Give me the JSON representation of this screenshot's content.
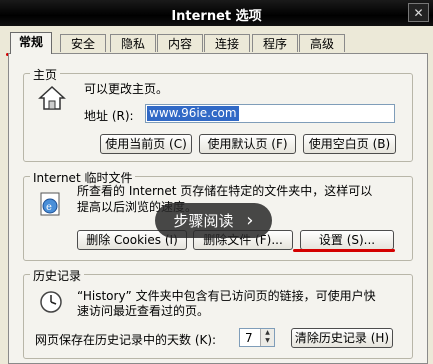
{
  "window": {
    "title": "Internet 选项",
    "close_glyph": "✕"
  },
  "tabs": [
    {
      "label": "常规",
      "active": true
    },
    {
      "label": "安全",
      "active": false
    },
    {
      "label": "隐私",
      "active": false
    },
    {
      "label": "内容",
      "active": false
    },
    {
      "label": "连接",
      "active": false
    },
    {
      "label": "程序",
      "active": false
    },
    {
      "label": "高级",
      "active": false
    }
  ],
  "homepage": {
    "group_label": "主页",
    "description": "可以更改主页。",
    "address_label": "地址 (R):",
    "address_value": "www.96ie.com",
    "buttons": {
      "use_current": "使用当前页 (C)",
      "use_default": "使用默认页 (F)",
      "use_blank": "使用空白页 (B)"
    }
  },
  "temp_files": {
    "group_label": "Internet 临时文件",
    "description_line1": "所查看的 Internet 页存储在特定的文件夹中，这样可以",
    "description_line2": "提高以后浏览的速度。",
    "buttons": {
      "delete_cookies": "删除 Cookies (I)",
      "delete_files": "删除文件 (F)...",
      "settings": "设置 (S)..."
    }
  },
  "history": {
    "group_label": "历史记录",
    "description_line1": "“History” 文件夹中包含有已访问页的链接，可使用户快",
    "description_line2": "速访问最近查看过的页。",
    "days_label": "网页保存在历史记录中的天数 (K):",
    "days_value": "7",
    "clear_button": "清除历史记录 (H)"
  },
  "overlay": {
    "label": "步骤阅读",
    "arrow": "›"
  },
  "colors": {
    "annotation_red": "#d40000",
    "selection_blue": "#3169c6"
  }
}
